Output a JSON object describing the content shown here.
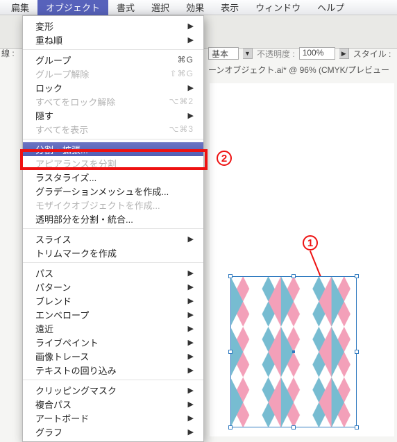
{
  "menubar": {
    "items": [
      {
        "label": "扁集"
      },
      {
        "label": "オブジェクト",
        "active": true
      },
      {
        "label": "書式"
      },
      {
        "label": "選択"
      },
      {
        "label": "効果"
      },
      {
        "label": "表示"
      },
      {
        "label": "ウィンドウ"
      },
      {
        "label": "ヘルプ"
      }
    ]
  },
  "left_label": "線 :",
  "options_bar": {
    "basic_label": "基本",
    "opacity_label": "不透明度 :",
    "opacity_value": "100%",
    "style_label": "スタイル :"
  },
  "doc_title": "ーンオブジェクト.ai* @ 96% (CMYK/プレビュー",
  "menu": {
    "items": [
      {
        "label": "変形",
        "sub": true
      },
      {
        "label": "重ね順",
        "sub": true
      },
      {
        "sep": true
      },
      {
        "label": "グループ",
        "shortcut": "⌘G"
      },
      {
        "label": "グループ解除",
        "shortcut": "⇧⌘G",
        "disabled": true
      },
      {
        "label": "ロック",
        "sub": true
      },
      {
        "label": "すべてをロック解除",
        "shortcut": "⌥⌘2",
        "disabled": true
      },
      {
        "label": "隠す",
        "sub": true
      },
      {
        "label": "すべてを表示",
        "shortcut": "⌥⌘3",
        "disabled": true
      },
      {
        "sep": true
      },
      {
        "label": "分割・拡張...",
        "highlight": true
      },
      {
        "label": "アピアランスを分割",
        "disabled": true
      },
      {
        "label": "ラスタライズ..."
      },
      {
        "label": "グラデーションメッシュを作成..."
      },
      {
        "label": "モザイクオブジェクトを作成...",
        "disabled": true
      },
      {
        "label": "透明部分を分割・統合..."
      },
      {
        "sep": true
      },
      {
        "label": "スライス",
        "sub": true
      },
      {
        "label": "トリムマークを作成"
      },
      {
        "sep": true
      },
      {
        "label": "パス",
        "sub": true
      },
      {
        "label": "パターン",
        "sub": true
      },
      {
        "label": "ブレンド",
        "sub": true
      },
      {
        "label": "エンベロープ",
        "sub": true
      },
      {
        "label": "遠近",
        "sub": true
      },
      {
        "label": "ライブペイント",
        "sub": true
      },
      {
        "label": "画像トレース",
        "sub": true
      },
      {
        "label": "テキストの回り込み",
        "sub": true
      },
      {
        "sep": true
      },
      {
        "label": "クリッピングマスク",
        "sub": true
      },
      {
        "label": "複合パス",
        "sub": true
      },
      {
        "label": "アートボード",
        "sub": true
      },
      {
        "label": "グラフ",
        "sub": true
      }
    ]
  },
  "annotations": {
    "one": "1",
    "two": "2"
  },
  "pattern_colors": {
    "pink": "#f3a0b9",
    "blue": "#77bcd1",
    "white": "#ffffff"
  }
}
